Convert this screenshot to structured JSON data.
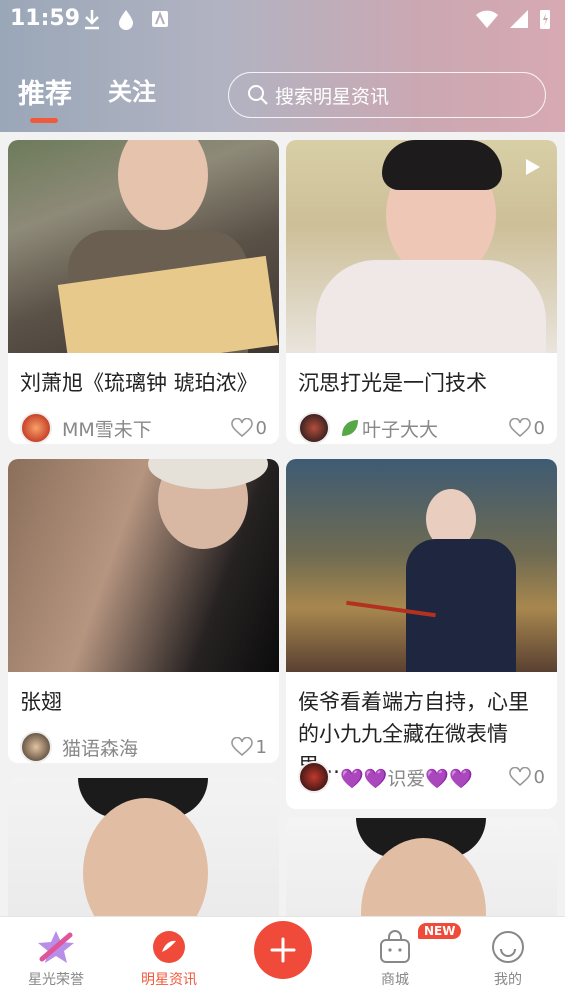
{
  "status_bar": {
    "time": "11:59"
  },
  "header": {
    "tabs": [
      {
        "label": "推荐",
        "active": true
      },
      {
        "label": "关注",
        "active": false
      }
    ],
    "search": {
      "placeholder": "搜索明星资讯"
    }
  },
  "feed": {
    "cards": [
      {
        "title": "刘萧旭《琉璃钟 琥珀浓》",
        "author": "MM雪未下",
        "likes": "0",
        "video": false
      },
      {
        "title": "沉思打光是一门技术",
        "author": "叶子大大",
        "likes": "0",
        "video": true
      },
      {
        "title": "张翅",
        "author": "猫语森海",
        "likes": "1",
        "video": false
      },
      {
        "title": "侯爷看着端方自持，心里的小九九全藏在微表情里…",
        "author": "💜💜识爱💜💜",
        "likes": "0",
        "video": false
      },
      {
        "title": "",
        "author": "",
        "likes": "",
        "video": false
      },
      {
        "title": "",
        "author": "",
        "likes": "",
        "video": false
      }
    ]
  },
  "bottom_nav": {
    "items": [
      {
        "label": "星光荣誉",
        "icon": "star-icon",
        "active": false
      },
      {
        "label": "明星资讯",
        "icon": "news-icon",
        "active": true
      },
      {
        "label": "",
        "icon": "plus-icon",
        "active": false
      },
      {
        "label": "商城",
        "icon": "shopping-bag-icon",
        "active": false,
        "badge": "NEW"
      },
      {
        "label": "我的",
        "icon": "profile-icon",
        "active": false
      }
    ]
  },
  "colors": {
    "accent": "#f04b3a",
    "text": "#222222",
    "muted": "#888888"
  }
}
